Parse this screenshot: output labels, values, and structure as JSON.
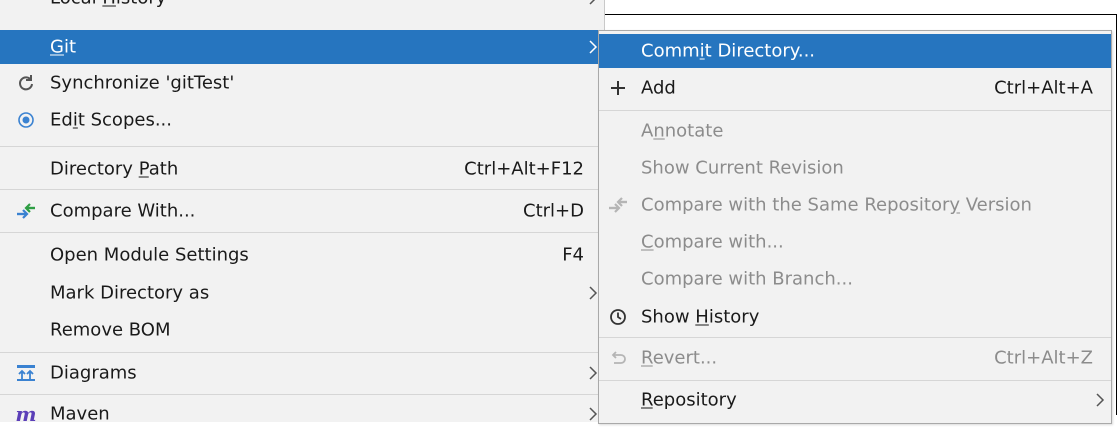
{
  "left_menu": {
    "items": [
      {
        "label": "Local History",
        "mnemonic": "H"
      },
      {
        "label": "Git",
        "mnemonic": "G"
      },
      {
        "label": "Synchronize 'gitTest'"
      },
      {
        "label": "Edit Scopes...",
        "mnemonic": "i"
      },
      {
        "label": "Directory Path",
        "mnemonic": "P",
        "shortcut": "Ctrl+Alt+F12"
      },
      {
        "label": "Compare With...",
        "shortcut": "Ctrl+D"
      },
      {
        "label": "Open Module Settings",
        "shortcut": "F4"
      },
      {
        "label": "Mark Directory as"
      },
      {
        "label": "Remove BOM"
      },
      {
        "label": "Diagrams"
      },
      {
        "label": "Maven"
      }
    ]
  },
  "git_submenu": {
    "items": [
      {
        "label": "Commit Directory...",
        "mnemonic": "i"
      },
      {
        "label": "Add",
        "shortcut": "Ctrl+Alt+A"
      },
      {
        "label": "Annotate",
        "mnemonic": "n"
      },
      {
        "label": "Show Current Revision"
      },
      {
        "label": "Compare with the Same Repository Version",
        "mnemonic": "y"
      },
      {
        "label": "Compare with...",
        "mnemonic": "C"
      },
      {
        "label": "Compare with Branch..."
      },
      {
        "label": "Show History",
        "mnemonic": "H"
      },
      {
        "label": "Revert...",
        "mnemonic": "R",
        "shortcut": "Ctrl+Alt+Z"
      },
      {
        "label": "Repository",
        "mnemonic": "R"
      }
    ]
  },
  "colors": {
    "selection": "#2675bf",
    "menu_background": "#f2f2f2",
    "disabled_text": "#8c8c8c",
    "icon_blue": "#3a82d1",
    "icon_purple": "#5b3fb8"
  }
}
